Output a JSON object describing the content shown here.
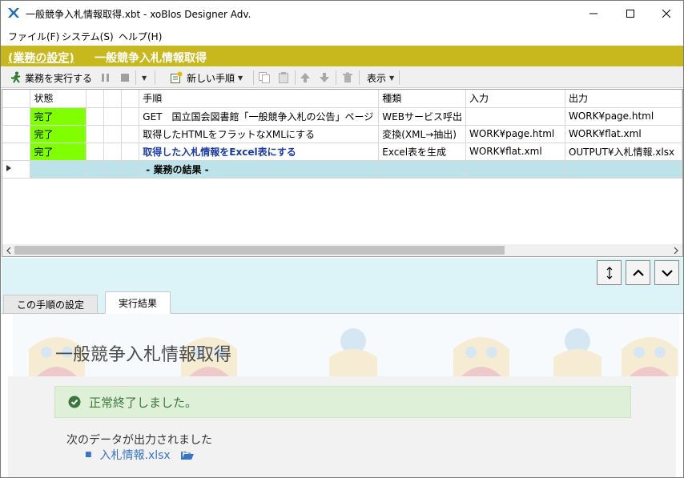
{
  "window": {
    "title": "一般競争入札情報取得.xbt - xoBlos Designer Adv."
  },
  "menu": {
    "items": [
      "ファイル(F)",
      "システム(S)",
      "ヘルプ(H)"
    ]
  },
  "header": {
    "link": "(業務の設定)",
    "title": "一般競争入札情報取得",
    "color": "#c8b81e"
  },
  "toolbar": {
    "run_label": "業務を実行する",
    "new_step_label": "新しい手順",
    "view_label": "表示"
  },
  "grid": {
    "columns": [
      "状態",
      "手順",
      "種類",
      "入力",
      "出力"
    ],
    "rows": [
      {
        "status": "完了",
        "step": "GET　国立国会図書館「一般競争入札の公告」ページ",
        "type": "WEBサービス呼出",
        "input": "",
        "output": "WORK¥page.html"
      },
      {
        "status": "完了",
        "step": "取得したHTMLをフラットなXMLにする",
        "type": "変換(XML→抽出)",
        "input": "WORK¥page.html",
        "output": "WORK¥flat.xml"
      },
      {
        "status": "完了",
        "step": "取得した入札情報をExcel表にする",
        "type": "Excel表を生成",
        "input": "WORK¥flat.xml",
        "output": "OUTPUT¥入札情報.xlsx"
      }
    ],
    "result_row": "- 業務の結果 -",
    "status_color": "#7fff00"
  },
  "tabs": {
    "settings": "この手順の設定",
    "results": "実行結果"
  },
  "pane": {
    "title": "一般競争入札情報取得",
    "alert": "正常終了しました。",
    "output_note": "次のデータが出力されました",
    "output_file": "入札情報.xlsx"
  }
}
